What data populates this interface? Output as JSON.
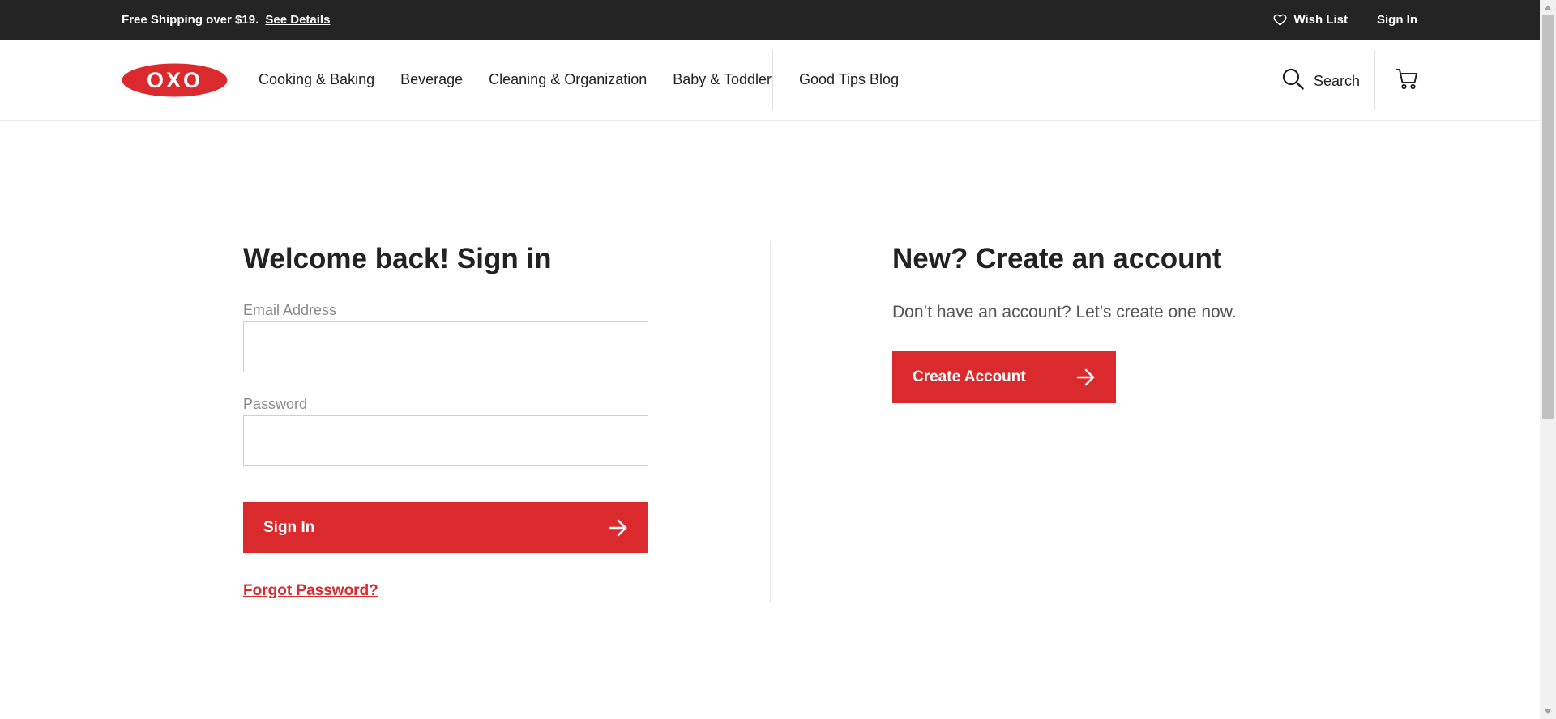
{
  "topbar": {
    "promo_text": "Free Shipping over $19.",
    "promo_link": "See Details",
    "wishlist_label": "Wish List",
    "signin_label": "Sign In"
  },
  "header": {
    "logo_text": "OXO",
    "nav": [
      "Cooking & Baking",
      "Beverage",
      "Cleaning & Organization",
      "Baby & Toddler"
    ],
    "blog_label": "Good Tips Blog",
    "search_label": "Search"
  },
  "signin": {
    "title": "Welcome back! Sign in",
    "email_label": "Email Address",
    "email_value": "",
    "password_label": "Password",
    "password_value": "",
    "button_label": "Sign In",
    "forgot_label": "Forgot Password?"
  },
  "create": {
    "title": "New? Create an account",
    "text": "Don’t have an account? Let’s create one now.",
    "button_label": "Create Account"
  },
  "colors": {
    "brand_red": "#da2a2e",
    "topbar_bg": "#242424"
  },
  "icons": [
    "heart-icon",
    "search-icon",
    "cart-icon",
    "arrow-right-icon"
  ]
}
